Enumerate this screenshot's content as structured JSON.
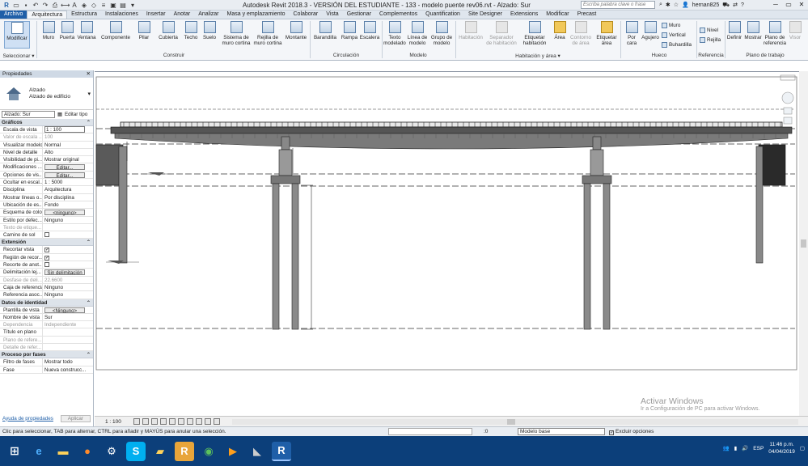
{
  "titlebar": {
    "title": "Autodesk Revit 2018.3 - VERSIÓN DEL ESTUDIANTE -   133 - modelo puente rev06.rvt - Alzado: Sur",
    "search_placeholder": "Escriba palabra clave o frase",
    "user": "hernan825",
    "help": "?"
  },
  "tabs": [
    {
      "label": "Archivo"
    },
    {
      "label": "Arquitectura"
    },
    {
      "label": "Estructura"
    },
    {
      "label": "Instalaciones"
    },
    {
      "label": "Insertar"
    },
    {
      "label": "Anotar"
    },
    {
      "label": "Analizar"
    },
    {
      "label": "Masa y emplazamiento"
    },
    {
      "label": "Colaborar"
    },
    {
      "label": "Vista"
    },
    {
      "label": "Gestionar"
    },
    {
      "label": "Complementos"
    },
    {
      "label": "Quantification"
    },
    {
      "label": "Site Designer"
    },
    {
      "label": "Extensions"
    },
    {
      "label": "Modificar"
    },
    {
      "label": "Precast"
    }
  ],
  "ribbon": {
    "modify": "Modificar",
    "select_label": "Seleccionar ▾",
    "buttons": [
      "Muro",
      "Puerta",
      "Ventana",
      "Componente",
      "Pilar",
      "Cubierta",
      "Techo",
      "Suelo",
      "Sistema de muro cortina",
      "Rejilla de muro cortina",
      "Montante",
      "Barandilla",
      "Rampa",
      "Escalera",
      "Texto modelado",
      "Línea de modelo",
      "Grupo de modelo",
      "Habitación",
      "Separador de habitación",
      "Etiquetar habitación",
      "Área",
      "Contorno de área",
      "Etiquetar área",
      "Por cara",
      "Agujero",
      "Definir",
      "Mostrar",
      "Plano de referencia",
      "Visor"
    ],
    "hueco_small": [
      "Muro",
      "Vertical",
      "Buhardilla"
    ],
    "ref_small": [
      "Nivel",
      "Rejilla"
    ],
    "panels": [
      "Construir",
      "Circulación",
      "Modelo",
      "Habitación y área ▾",
      "Hueco",
      "Referencia",
      "Plano de trabajo"
    ]
  },
  "props": {
    "header": "Propiedades",
    "type_line1": "Alzado",
    "type_line2": "Alzado de edificio",
    "view_select": "Alzado: Sur",
    "edit_type": "Editar tipo",
    "groups": [
      {
        "name": "Gráficos",
        "rows": [
          {
            "k": "Escala de vista",
            "v": "1 : 100",
            "kind": "input"
          },
          {
            "k": "Valor de escala ...",
            "v": "100",
            "kind": "dis"
          },
          {
            "k": "Visualizar modelo",
            "v": "Normal"
          },
          {
            "k": "Nivel de detalle",
            "v": "Alto"
          },
          {
            "k": "Visibilidad de pi...",
            "v": "Mostrar original"
          },
          {
            "k": "Modificaciones ...",
            "v": "Editar...",
            "kind": "btn"
          },
          {
            "k": "Opciones de vis...",
            "v": "Editar...",
            "kind": "btn"
          },
          {
            "k": "Ocultar en escal...",
            "v": "1 : 5000"
          },
          {
            "k": "Disciplina",
            "v": "Arquitectura"
          },
          {
            "k": "Mostrar líneas o...",
            "v": "Por disciplina"
          },
          {
            "k": "Ubicación de es...",
            "v": "Fondo"
          },
          {
            "k": "Esquema de color",
            "v": "<ninguno>",
            "kind": "btn"
          },
          {
            "k": "Estilo por defec...",
            "v": "Ninguno"
          },
          {
            "k": "Texto de etique...",
            "v": "",
            "kind": "dis"
          },
          {
            "k": "Camino de sol",
            "v": "",
            "kind": "cb0"
          }
        ]
      },
      {
        "name": "Extensión",
        "rows": [
          {
            "k": "Recortar vista",
            "v": "",
            "kind": "cb1"
          },
          {
            "k": "Región de recor...",
            "v": "",
            "kind": "cb1"
          },
          {
            "k": "Recorte de anot...",
            "v": "",
            "kind": "cb0"
          },
          {
            "k": "Delimitación lej...",
            "v": "Sin delimitación",
            "kind": "btn"
          },
          {
            "k": "Desfase de deli...",
            "v": "22.6600",
            "kind": "dis"
          },
          {
            "k": "Caja de referencia",
            "v": "Ninguno"
          },
          {
            "k": "Referencia asoc...",
            "v": "Ninguno"
          }
        ]
      },
      {
        "name": "Datos de identidad",
        "rows": [
          {
            "k": "Plantilla de vista",
            "v": "<Ninguno>",
            "kind": "btn"
          },
          {
            "k": "Nombre de vista",
            "v": "Sur"
          },
          {
            "k": "Dependencia",
            "v": "Independiente",
            "kind": "dis"
          },
          {
            "k": "Título en plano",
            "v": ""
          },
          {
            "k": "Plano de refere...",
            "v": "",
            "kind": "dis"
          },
          {
            "k": "Detalle de refer...",
            "v": "",
            "kind": "dis"
          }
        ]
      },
      {
        "name": "Proceso por fases",
        "rows": [
          {
            "k": "Filtro de fases",
            "v": "Mostrar todo"
          },
          {
            "k": "Fase",
            "v": "Nueva construcc..."
          }
        ]
      }
    ],
    "help_link": "Ayuda de propiedades",
    "apply": "Aplicar"
  },
  "viewbar": {
    "scale": "1 : 100"
  },
  "status": {
    "message": "Clic para seleccionar, TAB para alternar, CTRL para añadir y MAYÚS para anular una selección.",
    "zero": ":0",
    "model": "Modelo base",
    "exclude": "Excluir opciones"
  },
  "watermark": {
    "title": "Activar Windows",
    "sub": "Ir a Configuración de PC para activar Windows."
  },
  "taskbar": {
    "lang": "ESP",
    "time": "11:46 p.m.",
    "date": "04/04/2019"
  }
}
